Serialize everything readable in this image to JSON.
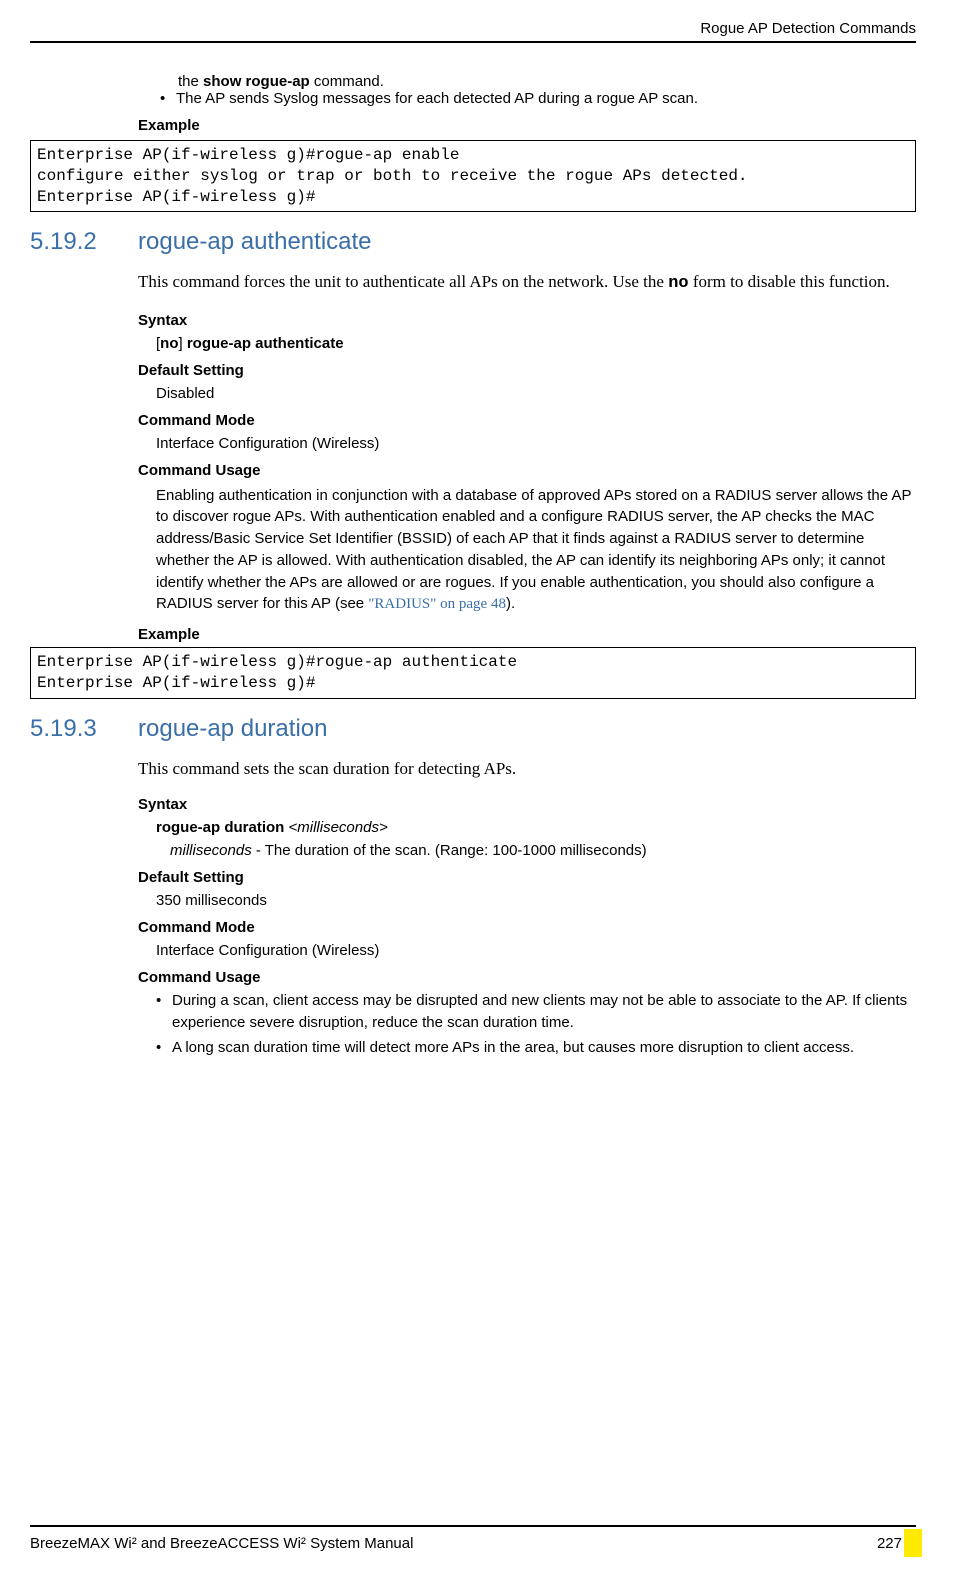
{
  "header": {
    "chapter_title": "Rogue AP Detection Commands"
  },
  "intro_tail": {
    "line1_prefix": "the ",
    "line1_bold": "show rogue-ap",
    "line1_suffix": " command.",
    "bullet_text": "The AP sends Syslog messages for each detected AP during a rogue AP scan."
  },
  "example1": {
    "label": "Example",
    "code": "Enterprise AP(if-wireless g)#rogue-ap enable\nconfigure either syslog or trap or both to receive the rogue APs detected.\nEnterprise AP(if-wireless g)#"
  },
  "section1": {
    "number": "5.19.2",
    "title": "rogue-ap authenticate",
    "desc_prefix": "This command forces the unit to authenticate all APs on the network. Use the ",
    "desc_bold": "no",
    "desc_suffix": " form to disable this function.",
    "syntax_label": "Syntax",
    "syntax_open": "[",
    "syntax_no": "no",
    "syntax_close": "] ",
    "syntax_cmd": "rogue-ap authenticate",
    "default_label": "Default Setting",
    "default_value": "Disabled",
    "mode_label": "Command Mode",
    "mode_value": "Interface Configuration (Wireless)",
    "usage_label": "Command Usage",
    "usage_text_pre": "Enabling authentication in conjunction with a database of approved APs stored on a RADIUS server allows the AP to discover rogue APs. With authentication enabled and a configure RADIUS server, the AP checks the MAC address/Basic Service Set Identifier (BSSID) of each AP that it finds against a RADIUS server to determine whether the AP is allowed. With authentication disabled, the AP can identify its neighboring APs only; it cannot identify whether the APs are allowed or are rogues. If you enable authentication, you should also configure a RADIUS server for this AP (see ",
    "usage_link": "\"RADIUS\" on page 48",
    "usage_text_post": ").",
    "example_label": "Example",
    "example_code": "Enterprise AP(if-wireless g)#rogue-ap authenticate\nEnterprise AP(if-wireless g)#"
  },
  "section2": {
    "number": "5.19.3",
    "title": "rogue-ap duration",
    "desc": "This command sets the scan duration for detecting APs.",
    "syntax_label": "Syntax",
    "syntax_cmd": "rogue-ap duration ",
    "syntax_arg": "<milliseconds>",
    "arg_name": "milliseconds",
    "arg_desc": " - The duration of the scan. (Range: 100-1000 milliseconds)",
    "default_label": "Default Setting",
    "default_value": "350 milliseconds",
    "mode_label": "Command Mode",
    "mode_value": "Interface Configuration (Wireless)",
    "usage_label": "Command Usage",
    "bullet1": "During a scan, client access may be disrupted and new clients may not be able to associate to the AP. If clients experience severe disruption, reduce the scan duration time.",
    "bullet2": "A long scan duration time will detect more APs in the area, but causes more disruption to client access."
  },
  "footer": {
    "manual_title": "BreezeMAX Wi² and BreezeACCESS Wi² System Manual",
    "page_number": "227"
  }
}
